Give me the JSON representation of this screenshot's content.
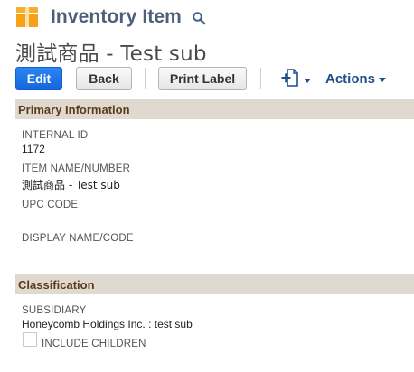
{
  "header": {
    "record_type": "Inventory Item",
    "record_icon": "inventory-box-icon",
    "search_icon": "search-icon"
  },
  "record": {
    "title": "測試商品 - Test sub"
  },
  "toolbar": {
    "edit_label": "Edit",
    "back_label": "Back",
    "print_label": "Print Label",
    "new_document_icon": "new-document-icon",
    "actions_label": "Actions"
  },
  "sections": {
    "primary": {
      "title": "Primary Information",
      "fields": {
        "internal_id": {
          "label": "INTERNAL ID",
          "value": "1172"
        },
        "item_name": {
          "label": "ITEM NAME/NUMBER",
          "value": "測試商品 - Test sub"
        },
        "upc_code": {
          "label": "UPC CODE",
          "value": ""
        },
        "display_name": {
          "label": "DISPLAY NAME/CODE",
          "value": ""
        }
      }
    },
    "classification": {
      "title": "Classification",
      "fields": {
        "subsidiary": {
          "label": "SUBSIDIARY",
          "value": "Honeycomb Holdings Inc. : test sub"
        },
        "include_children": {
          "label": "INCLUDE CHILDREN",
          "checked": false
        }
      }
    }
  },
  "colors": {
    "primary_button": "#1a73e8",
    "page_type_text": "#4d5f79",
    "section_bar": "#e0d9cf",
    "section_text": "#5a3b1a",
    "actions_text": "#1f4f8c",
    "icon_orange": "#f7a11a"
  }
}
